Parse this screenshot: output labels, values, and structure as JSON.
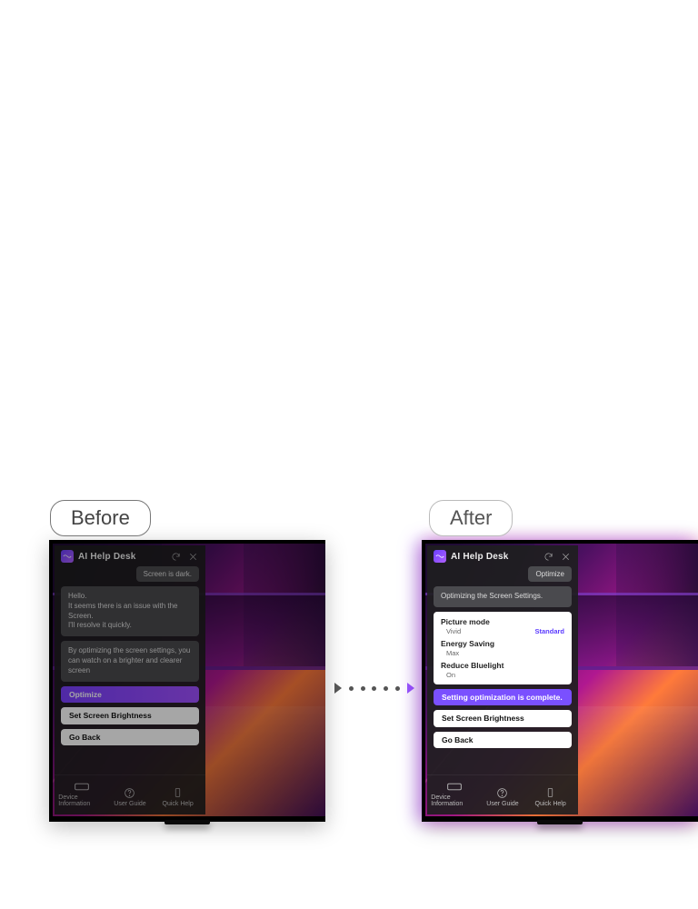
{
  "labels": {
    "before": "Before",
    "after": "After"
  },
  "panel": {
    "title": "AI Help Desk",
    "footer": {
      "device_info": "Device Information",
      "user_guide": "User Guide",
      "quick_help": "Quick Help"
    }
  },
  "before": {
    "user_msg": "Screen is dark.",
    "ai_msg_1": "Hello.\nIt seems there is an issue with the Screen.\nI'll resolve it quickly.",
    "ai_msg_2": "By optimizing the screen settings, you can watch on a brighter and clearer screen",
    "btn_primary": "Optimize",
    "btn_2": "Set Screen Brightness",
    "btn_3": "Go Back"
  },
  "after": {
    "user_msg": "Optimize",
    "ai_msg_1": "Optimizing the Screen Settings.",
    "settings": {
      "picture_mode": {
        "label": "Picture mode",
        "old": "Vivid",
        "new": "Standard"
      },
      "energy_saving": {
        "label": "Energy Saving",
        "old": "Max",
        "new": ""
      },
      "reduce_bluelight": {
        "label": "Reduce Bluelight",
        "old": "On",
        "new": ""
      }
    },
    "status": "Setting optimization is complete.",
    "btn_2": "Set Screen Brightness",
    "btn_3": "Go Back"
  }
}
